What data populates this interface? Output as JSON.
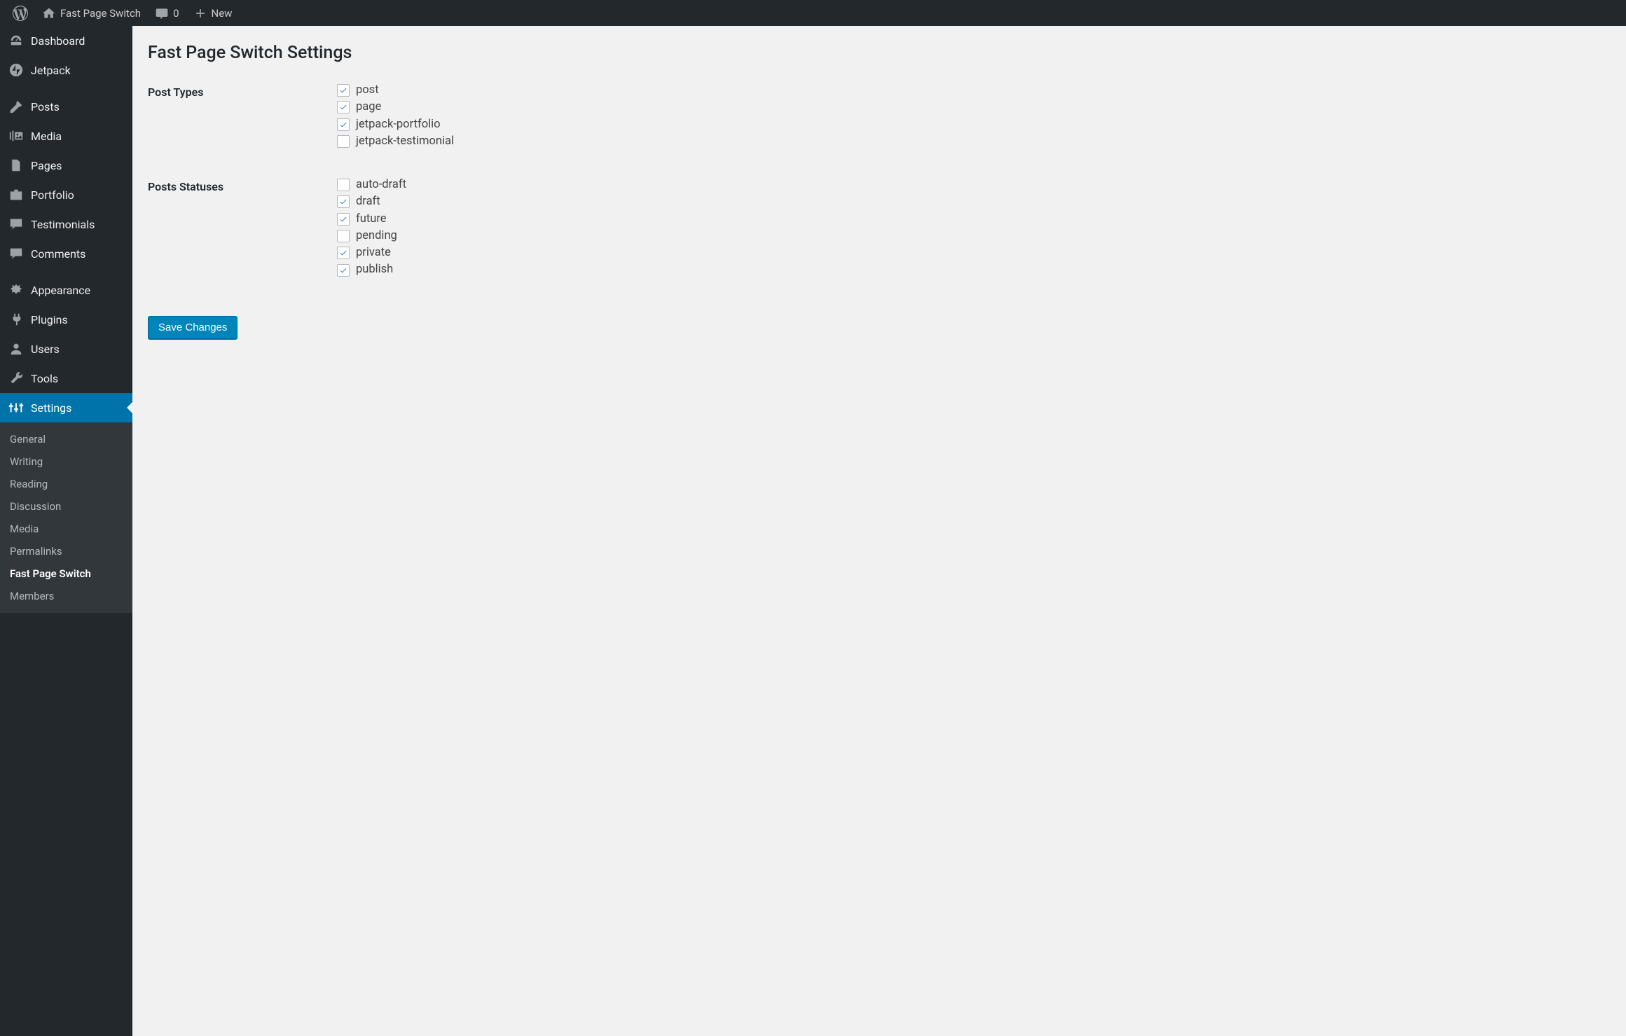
{
  "admin_bar": {
    "site_title": "Fast Page Switch",
    "comments_count": "0",
    "new_label": "New"
  },
  "sidebar": {
    "items": [
      {
        "label": "Dashboard",
        "icon": "dashboard"
      },
      {
        "label": "Jetpack",
        "icon": "jetpack"
      },
      {
        "label": "Posts",
        "icon": "posts",
        "sep_before": true
      },
      {
        "label": "Media",
        "icon": "media"
      },
      {
        "label": "Pages",
        "icon": "pages"
      },
      {
        "label": "Portfolio",
        "icon": "portfolio"
      },
      {
        "label": "Testimonials",
        "icon": "testimonials"
      },
      {
        "label": "Comments",
        "icon": "comments"
      },
      {
        "label": "Appearance",
        "icon": "appearance",
        "sep_before": true
      },
      {
        "label": "Plugins",
        "icon": "plugins"
      },
      {
        "label": "Users",
        "icon": "users"
      },
      {
        "label": "Tools",
        "icon": "tools"
      },
      {
        "label": "Settings",
        "icon": "settings",
        "current": true
      }
    ],
    "submenu": [
      {
        "label": "General"
      },
      {
        "label": "Writing"
      },
      {
        "label": "Reading"
      },
      {
        "label": "Discussion"
      },
      {
        "label": "Media"
      },
      {
        "label": "Permalinks"
      },
      {
        "label": "Fast Page Switch",
        "active": true
      },
      {
        "label": "Members"
      }
    ]
  },
  "page": {
    "title": "Fast Page Switch Settings",
    "sections": [
      {
        "heading": "Post Types",
        "options": [
          {
            "label": "post",
            "checked": true
          },
          {
            "label": "page",
            "checked": true
          },
          {
            "label": "jetpack-portfolio",
            "checked": true
          },
          {
            "label": "jetpack-testimonial",
            "checked": false
          }
        ]
      },
      {
        "heading": "Posts Statuses",
        "options": [
          {
            "label": "auto-draft",
            "checked": false
          },
          {
            "label": "draft",
            "checked": true
          },
          {
            "label": "future",
            "checked": true
          },
          {
            "label": "pending",
            "checked": false
          },
          {
            "label": "private",
            "checked": true
          },
          {
            "label": "publish",
            "checked": true
          }
        ]
      }
    ],
    "save_button": "Save Changes"
  }
}
